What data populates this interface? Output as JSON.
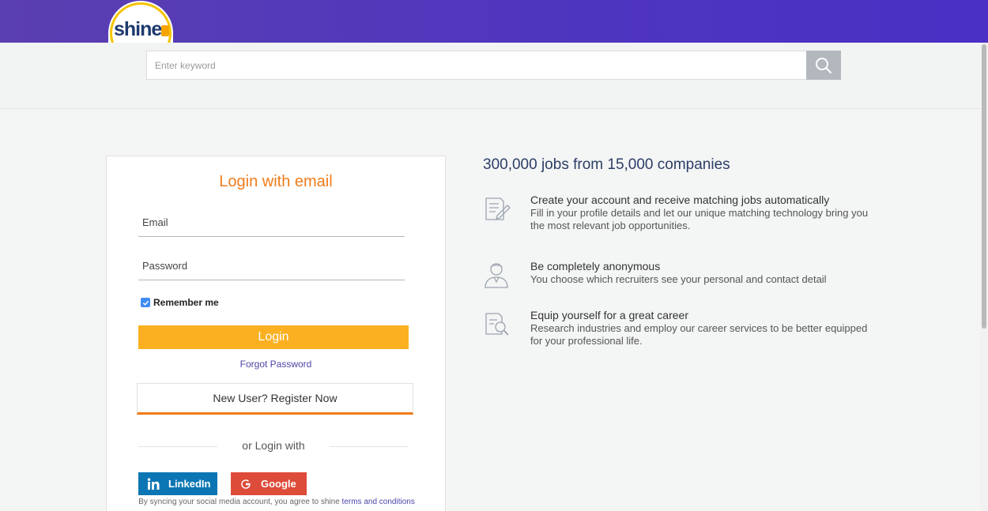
{
  "header": {
    "logo_text": "shine",
    "search_placeholder": "Enter keyword"
  },
  "login": {
    "title": "Login with email",
    "email_placeholder": "Email",
    "password_placeholder": "Password",
    "remember_label": "Remember me",
    "remember_checked": true,
    "login_button": "Login",
    "forgot_link": "Forgot Password",
    "register_button": "New User? Register Now",
    "or_text": "or Login with",
    "linkedin_label": "LinkedIn",
    "google_label": "Google",
    "disclaimer_text": "By syncing your social media account, you agree to shine ",
    "disclaimer_link": "terms and conditions"
  },
  "info": {
    "headline": "300,000 jobs from 15,000 companies",
    "features": [
      {
        "icon": "profile-form-icon",
        "title": "Create your account and receive matching jobs automatically",
        "description": "Fill in your profile details and let our unique matching technology bring you the most relevant job opportunities."
      },
      {
        "icon": "anonymous-user-icon",
        "title": "Be completely anonymous",
        "description": "You choose which recruiters see your personal and contact detail"
      },
      {
        "icon": "career-research-icon",
        "title": "Equip yourself for a great career",
        "description": "Research industries and employ our career services to be better equipped for your professional life."
      }
    ]
  },
  "colors": {
    "header_purple": "#4e35c0",
    "accent_orange": "#f07c1a",
    "login_yellow": "#fbb021",
    "linkedin_blue": "#0c76b4",
    "google_red": "#dd4b39"
  }
}
